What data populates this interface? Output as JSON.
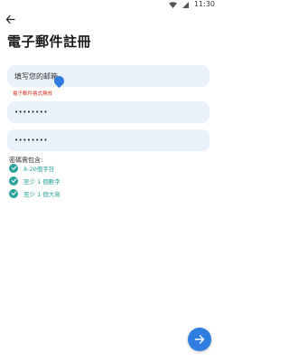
{
  "status_bar": {
    "time": "11:30"
  },
  "header": {
    "title": "電子郵件註冊"
  },
  "form": {
    "email_value": "填写您的邮箱",
    "email_error": "電子郵件格式無效",
    "password_mask": "••••••••",
    "confirm_password_mask": "••••••••"
  },
  "requirements": {
    "label": "密碼需包含:",
    "items": [
      "8-20個字符",
      "至少 1 個數字",
      "至少 1 個大寫"
    ]
  },
  "colors": {
    "accent": "#2f7de1",
    "field_bg": "#e9f1fb",
    "error": "#d93025",
    "success": "#2aa39a"
  },
  "icons": {
    "back": "arrow-left-icon",
    "next": "arrow-right-icon",
    "check": "check-circle-icon"
  }
}
